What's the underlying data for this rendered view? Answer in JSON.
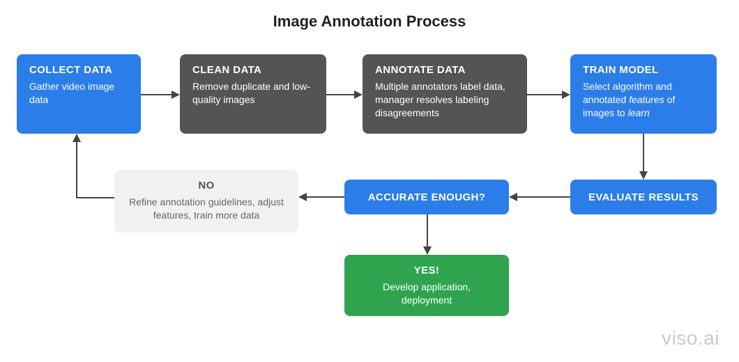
{
  "title": "Image Annotation Process",
  "watermark": "viso.ai",
  "nodes": {
    "collect": {
      "header": "COLLECT DATA",
      "body": "Gather video image data"
    },
    "clean": {
      "header": "CLEAN DATA",
      "body": "Remove duplicate and low-quality images"
    },
    "annotate": {
      "header": "ANNOTATE DATA",
      "body": "Multiple annotators label data, manager resolves labeling disagreements"
    },
    "train": {
      "header": "TRAIN MODEL",
      "body_html": "Select algorithm and annotated <em>features</em> of images to <em>learn</em>"
    },
    "evaluate": {
      "header": "EVALUATE RESULTS"
    },
    "accurate": {
      "header": "ACCURATE ENOUGH?"
    },
    "no": {
      "header": "NO",
      "body": "Refine annotation guidelines, adjust features, train more data"
    },
    "yes": {
      "header": "YES!",
      "body": "Develop application, deployment"
    }
  },
  "colors": {
    "blue": "#2b7de9",
    "dark": "#545454",
    "green": "#2ea44f",
    "light": "#f1f1f1",
    "arrow": "#444444"
  }
}
